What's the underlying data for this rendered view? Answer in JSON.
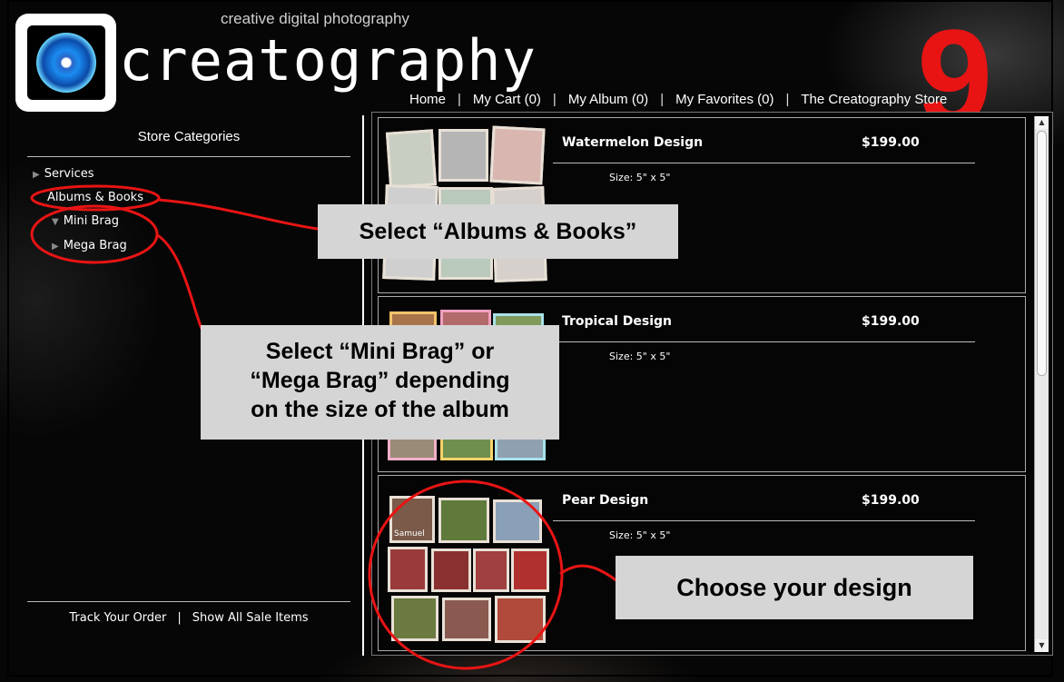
{
  "header": {
    "tagline": "creative digital photography",
    "brand": "creatography",
    "step_number": "9"
  },
  "nav": {
    "items": [
      "Home",
      "My Cart (0)",
      "My Album (0)",
      "My Favorites (0)",
      "The Creatography Store"
    ],
    "separator": "|"
  },
  "sidebar": {
    "title": "Store Categories",
    "categories": [
      {
        "label": "Services",
        "expanded": false
      },
      {
        "label": "Albums & Books",
        "expanded": true
      },
      {
        "label": "Mini Brag",
        "expanded": true
      },
      {
        "label": "Mega Brag",
        "expanded": false
      }
    ],
    "footer": [
      "Track Your Order",
      "Show All Sale Items"
    ],
    "footer_separator": "|"
  },
  "products": [
    {
      "name": "Watermelon Design",
      "price": "$199.00",
      "size": "Size: 5\" x 5\""
    },
    {
      "name": "Tropical Design",
      "price": "$199.00",
      "size": "Size: 5\" x 5\""
    },
    {
      "name": "Pear Design",
      "price": "$199.00",
      "size": "Size: 5\" x 5\"",
      "thumb_caption": "Samuel"
    }
  ],
  "callouts": {
    "albums": "Select “Albums & Books”",
    "brag_line1": "Select “Mini Brag” or",
    "brag_line2": "“Mega Brag” depending",
    "brag_line3": "on the size of the album",
    "design": "Choose your design"
  },
  "colors": {
    "annotation_red": "#e81414",
    "callout_bg": "#d5d5d5",
    "page_bg": "#060606"
  }
}
